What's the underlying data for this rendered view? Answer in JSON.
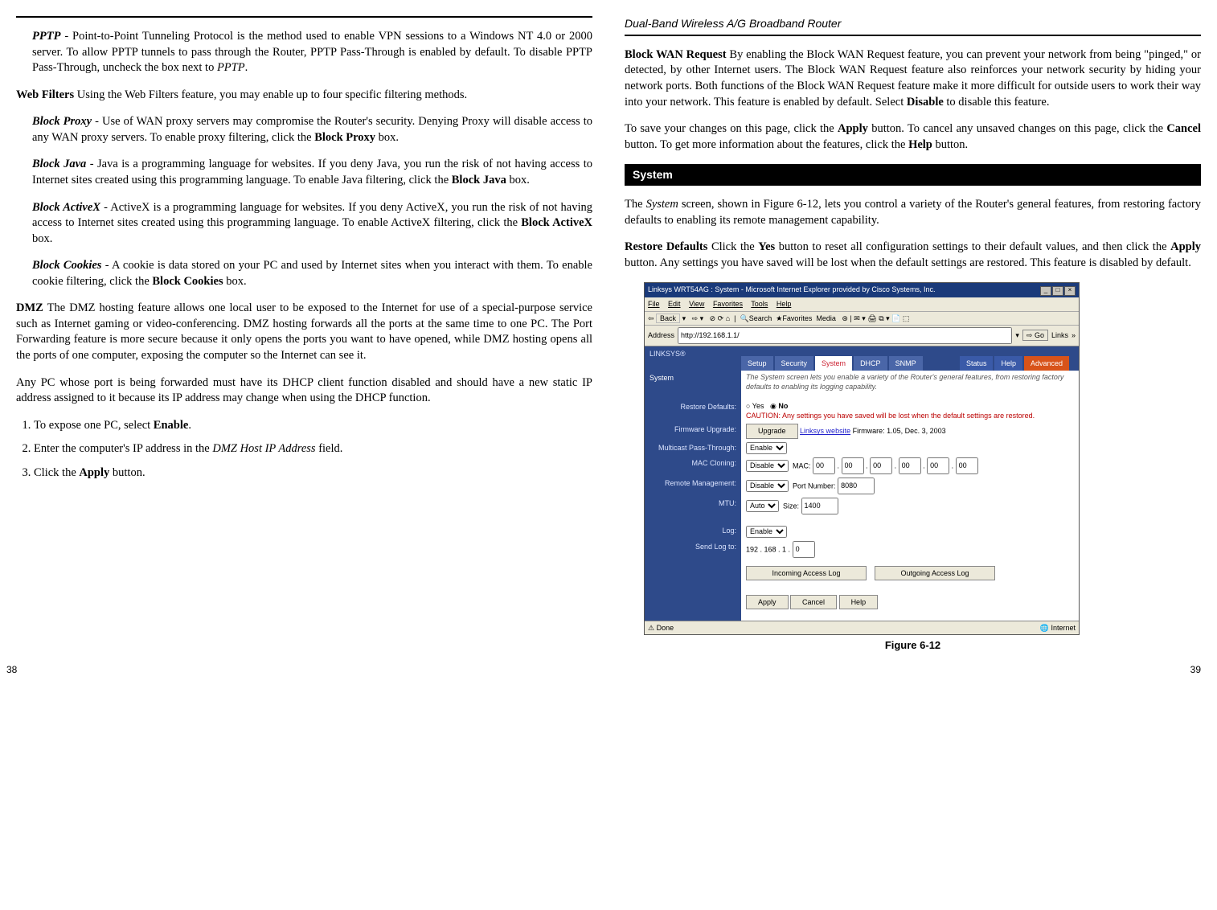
{
  "left": {
    "pptp": {
      "label": "PPTP",
      "text": " - Point-to-Point Tunneling Protocol is the method used to enable VPN sessions to a Windows NT 4.0 or 2000 server. To allow PPTP tunnels to pass through the Router, PPTP Pass-Through is enabled by default. To disable PPTP Pass-Through, uncheck the box next to ",
      "trail_i": "PPTP",
      "trail": "."
    },
    "webfilters": {
      "label": "Web Filters",
      "text": "  Using the Web Filters feature, you may enable up to four specific filtering methods."
    },
    "proxy": {
      "label": "Block Proxy",
      "text": " - Use of WAN proxy servers may compromise the Router's security. Denying Proxy will disable access to any WAN proxy servers. To enable proxy filtering, click the ",
      "bold": "Block Proxy",
      "trail": " box."
    },
    "java": {
      "label": "Block Java",
      "text": " - Java is a programming language for websites. If you deny Java, you run the risk of not having access to Internet sites created using this programming language. To enable Java filtering, click the ",
      "bold": "Block Java",
      "trail": " box."
    },
    "activex": {
      "label": "Block ActiveX",
      "text": " - ActiveX is a programming language for websites. If you deny ActiveX, you run the risk of not having access to Internet sites created using this programming language. To enable ActiveX filtering, click the ",
      "bold": "Block ActiveX",
      "trail": " box."
    },
    "cookies": {
      "label": "Block Cookies",
      "text": " - A cookie is data stored on your PC and used by Internet sites when you interact with them. To enable cookie filtering, click the ",
      "bold": "Block Cookies",
      "trail": " box."
    },
    "dmz": {
      "label": "DMZ",
      "text": "  The DMZ hosting feature allows one local user to be exposed to the Internet for use of a special-purpose service such as Internet gaming or video-conferencing. DMZ hosting forwards all the ports at the same time to one PC. The Port Forwarding feature is more secure because it only opens the ports you want to have opened, while DMZ hosting opens all the ports of one computer, exposing the computer so the Internet can see it."
    },
    "dmz2": "Any PC whose port is being forwarded must have its DHCP client function disabled and should have a new static IP address assigned to it because its IP address may change when using the DHCP function.",
    "steps": {
      "s1a": "To expose one PC, select ",
      "s1b": "Enable",
      "s1c": ".",
      "s2a": "Enter the computer's IP address in the ",
      "s2b": "DMZ Host IP Address",
      "s2c": " field.",
      "s3a": "Click the ",
      "s3b": "Apply",
      "s3c": " button."
    },
    "pageno": "38"
  },
  "right": {
    "running_head": "Dual-Band Wireless A/G Broadband Router",
    "wan": {
      "label": "Block WAN Request",
      "t1": "  By enabling the Block WAN Request feature, you can prevent your network from being \"pinged,\" or detected, by other Internet users. The Block WAN Request feature also reinforces your network security by hiding your network ports. Both functions of the Block WAN Request feature make it more difficult for outside users to work their way into your network. This feature is enabled by default. Select ",
      "b1": "Disable",
      "t2": " to disable this feature."
    },
    "save": {
      "t1": "To save your changes on this page, click the ",
      "b1": "Apply",
      "t2": " button. To cancel any unsaved changes on this page, click the ",
      "b2": "Cancel",
      "t3": " button. To get more information about the features, click the ",
      "b3": "Help",
      "t4": " button."
    },
    "section": "System",
    "sys": {
      "t1": "The ",
      "i1": "System",
      "t2": " screen, shown in Figure 6-12, lets you control a variety of the Router's general features, from restoring factory defaults to enabling its remote management capability."
    },
    "restore": {
      "label": "Restore Defaults",
      "t1": "  Click the ",
      "b1": "Yes",
      "t2": " button to reset all configuration settings to their default values, and then click the ",
      "b2": "Apply",
      "t3": " button. Any settings you have saved will be lost when the default settings are restored. This feature is disabled by default."
    },
    "fig_caption": "Figure 6-12",
    "pageno": "39"
  },
  "shot": {
    "title": "Linksys WRT54AG : System - Microsoft Internet Explorer provided by Cisco Systems, Inc.",
    "menus": [
      "File",
      "Edit",
      "View",
      "Favorites",
      "Tools",
      "Help"
    ],
    "toolbar": {
      "back": "Back",
      "search": "Search",
      "fav": "Favorites",
      "media": "Media"
    },
    "addr_label": "Address",
    "addr_value": "http://192.168.1.1/",
    "go": "Go",
    "links": "Links",
    "brand": "LINKSYS®",
    "tabs": [
      "Setup",
      "Security",
      "System",
      "DHCP",
      "SNMP"
    ],
    "tabs_right": [
      "Status",
      "Help",
      "Advanced"
    ],
    "side_big": "System",
    "desc": "The System screen lets you enable a variety of the Router's general features, from restoring factory defaults to enabling its logging capability.",
    "labels": {
      "restore": "Restore Defaults:",
      "fw": "Firmware Upgrade:",
      "mpt": "Multicast Pass-Through:",
      "mac": "MAC Cloning:",
      "rm": "Remote Management:",
      "mtu": "MTU:",
      "log": "Log:",
      "sendlog": "Send Log to:"
    },
    "restore_yes": "Yes",
    "restore_no": "No",
    "caution": "CAUTION: Any settings you have saved will be lost when the default settings are restored.",
    "upgrade_btn": "Upgrade",
    "linksys_site": "Linksys website",
    "fw_info": "Firmware: 1.05, Dec. 3, 2003",
    "enable": "Enable",
    "disable": "Disable",
    "auto": "Auto",
    "mac_label": "MAC:",
    "mac_vals": [
      "00",
      "00",
      "00",
      "00",
      "00",
      "00"
    ],
    "port_label": "Port Number:",
    "port_val": "8080",
    "size_label": "Size:",
    "size_val": "1400",
    "sendlog_ip_prefix": "192 . 168 . 1 .",
    "sendlog_ip_last": "0",
    "in_log": "Incoming Access Log",
    "out_log": "Outgoing Access Log",
    "apply": "Apply",
    "cancel": "Cancel",
    "help": "Help",
    "status_done": "Done",
    "status_net": "Internet"
  }
}
